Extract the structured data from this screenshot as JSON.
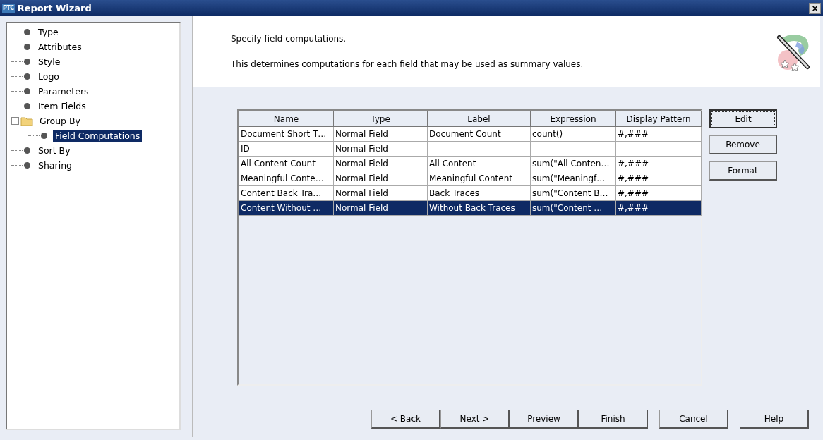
{
  "window": {
    "logo": "PTC",
    "title": "Report Wizard",
    "close": "×"
  },
  "tree": [
    {
      "label": "Type",
      "kind": "leaf",
      "selected": false
    },
    {
      "label": "Attributes",
      "kind": "leaf",
      "selected": false
    },
    {
      "label": "Style",
      "kind": "leaf",
      "selected": false
    },
    {
      "label": "Logo",
      "kind": "leaf",
      "selected": false
    },
    {
      "label": "Parameters",
      "kind": "leaf",
      "selected": false
    },
    {
      "label": "Item Fields",
      "kind": "leaf",
      "selected": false
    },
    {
      "label": "Group By",
      "kind": "folder",
      "selected": false,
      "expanded": true,
      "children": [
        {
          "label": "Field Computations",
          "kind": "leaf",
          "selected": true
        }
      ]
    },
    {
      "label": "Sort By",
      "kind": "leaf",
      "selected": false
    },
    {
      "label": "Sharing",
      "kind": "leaf",
      "selected": false
    }
  ],
  "header": {
    "heading": "Specify field computations.",
    "description": "This determines computations for each field that may be used as summary values."
  },
  "table": {
    "columns": [
      "Name",
      "Type",
      "Label",
      "Expression",
      "Display Pattern"
    ],
    "rows": [
      {
        "cells": [
          "Document Short T…",
          "Normal Field",
          "Document Count",
          "count()",
          "#,###"
        ],
        "selected": false
      },
      {
        "cells": [
          "ID",
          "Normal Field",
          "",
          "",
          ""
        ],
        "selected": false
      },
      {
        "cells": [
          "All Content Count",
          "Normal Field",
          "All Content",
          "sum(\"All Conten…",
          "#,###"
        ],
        "selected": false
      },
      {
        "cells": [
          "Meaningful Conte…",
          "Normal Field",
          "Meaningful Content",
          "sum(\"Meaningf…",
          "#,###"
        ],
        "selected": false
      },
      {
        "cells": [
          "Content Back Tra…",
          "Normal Field",
          "Back Traces",
          "sum(\"Content B…",
          "#,###"
        ],
        "selected": false
      },
      {
        "cells": [
          "Content Without …",
          "Normal Field",
          "Without Back Traces",
          "sum(\"Content …",
          "#,###"
        ],
        "selected": true
      }
    ]
  },
  "side_buttons": [
    {
      "label": "Edit",
      "focused": true
    },
    {
      "label": "Remove",
      "focused": false
    },
    {
      "label": "Format",
      "focused": false
    }
  ],
  "footer_buttons": [
    "< Back",
    "Next >",
    "Preview",
    "Finish",
    "Cancel",
    "Help"
  ]
}
